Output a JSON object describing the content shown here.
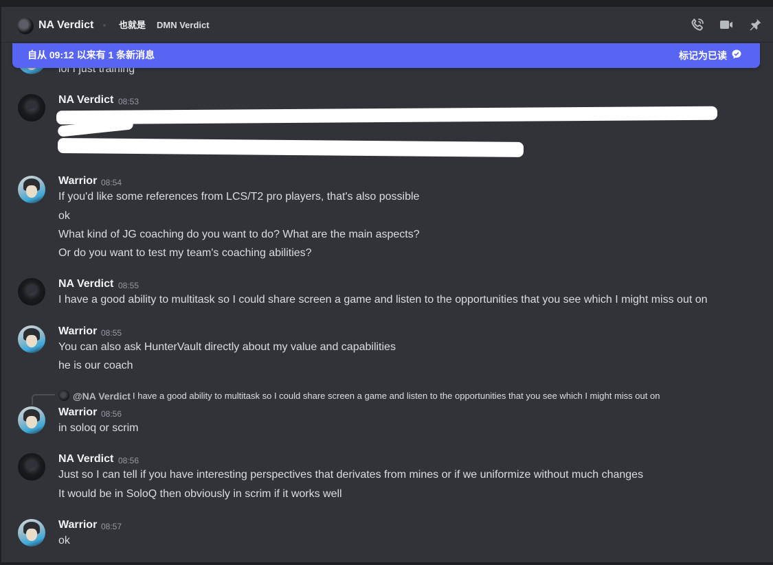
{
  "header": {
    "title": "NA Verdict",
    "aka_label": "也就是",
    "aka_name": "DMN Verdict",
    "icons": [
      "phone-call-icon",
      "video-camera-icon",
      "pin-icon"
    ]
  },
  "banner": {
    "text": "自从 09:12 以来有 1 条新消息",
    "action": "标记为已读"
  },
  "messages": [
    {
      "author": "",
      "time": "",
      "lines": [
        "lol I just training"
      ]
    },
    {
      "author": "NA Verdict",
      "time": "08:53",
      "lines": []
    },
    {
      "author": "Warrior",
      "time": "08:54",
      "lines": [
        "If you'd like some references from LCS/T2 pro players, that's also possible",
        "ok",
        "What kind of JG coaching do you want to do? What are the main aspects?",
        "Or do you want to test my team's coaching abilities?"
      ]
    },
    {
      "author": "NA Verdict",
      "time": "08:55",
      "lines": [
        "I have a good ability to multitask so I could share screen a game and listen to the opportunities that you see which I might miss out on"
      ]
    },
    {
      "author": "Warrior",
      "time": "08:55",
      "lines": [
        "You can also ask HunterVault directly about my value and capabilities",
        "he is our coach"
      ]
    },
    {
      "author": "Warrior",
      "time": "08:56",
      "reply": {
        "name": "@NA Verdict",
        "text": "I have a good ability to multitask so I could share screen a game and listen to the opportunities that you see which I might miss out on"
      },
      "lines": [
        "in soloq or scrim"
      ]
    },
    {
      "author": "NA Verdict",
      "time": "08:56",
      "lines": [
        "Just so I can tell if you have interesting perspectives that derivates from mines or if we uniformize without much changes",
        "It would be in SoloQ then obviously in scrim if it works well"
      ]
    },
    {
      "author": "Warrior",
      "time": "08:57",
      "lines": [
        "ok"
      ]
    }
  ]
}
